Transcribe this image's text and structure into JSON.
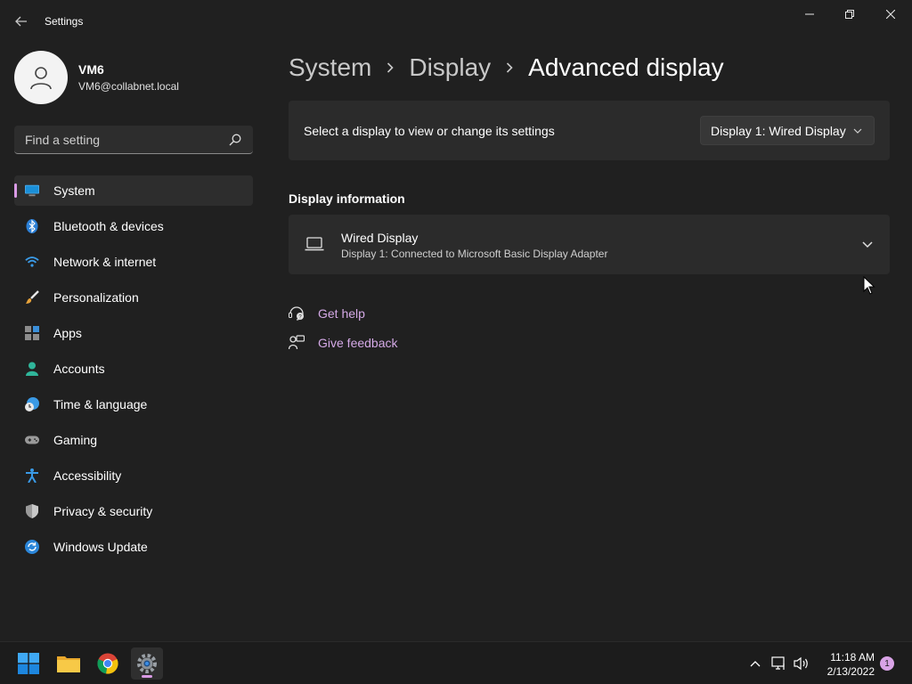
{
  "window": {
    "title": "Settings",
    "buttons": [
      "minimize",
      "maximize",
      "close"
    ]
  },
  "profile": {
    "name": "VM6",
    "email": "VM6@collabnet.local"
  },
  "search": {
    "placeholder": "Find a setting"
  },
  "sidebar": {
    "items": [
      {
        "label": "System",
        "icon": "monitor-icon",
        "active": true
      },
      {
        "label": "Bluetooth & devices",
        "icon": "bluetooth-icon"
      },
      {
        "label": "Network & internet",
        "icon": "wifi-icon"
      },
      {
        "label": "Personalization",
        "icon": "brush-icon"
      },
      {
        "label": "Apps",
        "icon": "apps-icon"
      },
      {
        "label": "Accounts",
        "icon": "person-icon"
      },
      {
        "label": "Time & language",
        "icon": "globe-clock-icon"
      },
      {
        "label": "Gaming",
        "icon": "gamepad-icon"
      },
      {
        "label": "Accessibility",
        "icon": "accessibility-icon"
      },
      {
        "label": "Privacy & security",
        "icon": "shield-icon"
      },
      {
        "label": "Windows Update",
        "icon": "update-icon"
      }
    ]
  },
  "breadcrumb": {
    "items": [
      "System",
      "Display",
      "Advanced display"
    ]
  },
  "select_card": {
    "label": "Select a display to view or change its settings",
    "dropdown_value": "Display 1: Wired Display"
  },
  "display_info": {
    "section_title": "Display information",
    "title": "Wired Display",
    "subtitle": "Display 1: Connected to Microsoft Basic Display Adapter"
  },
  "links": {
    "help": "Get help",
    "feedback": "Give feedback"
  },
  "taskbar": {
    "time": "11:18 AM",
    "date": "2/13/2022",
    "notification_count": "1"
  },
  "colors": {
    "accent": "#d99ae5",
    "background": "#202020",
    "card": "#2b2b2b",
    "link": "#d4a9e6"
  }
}
